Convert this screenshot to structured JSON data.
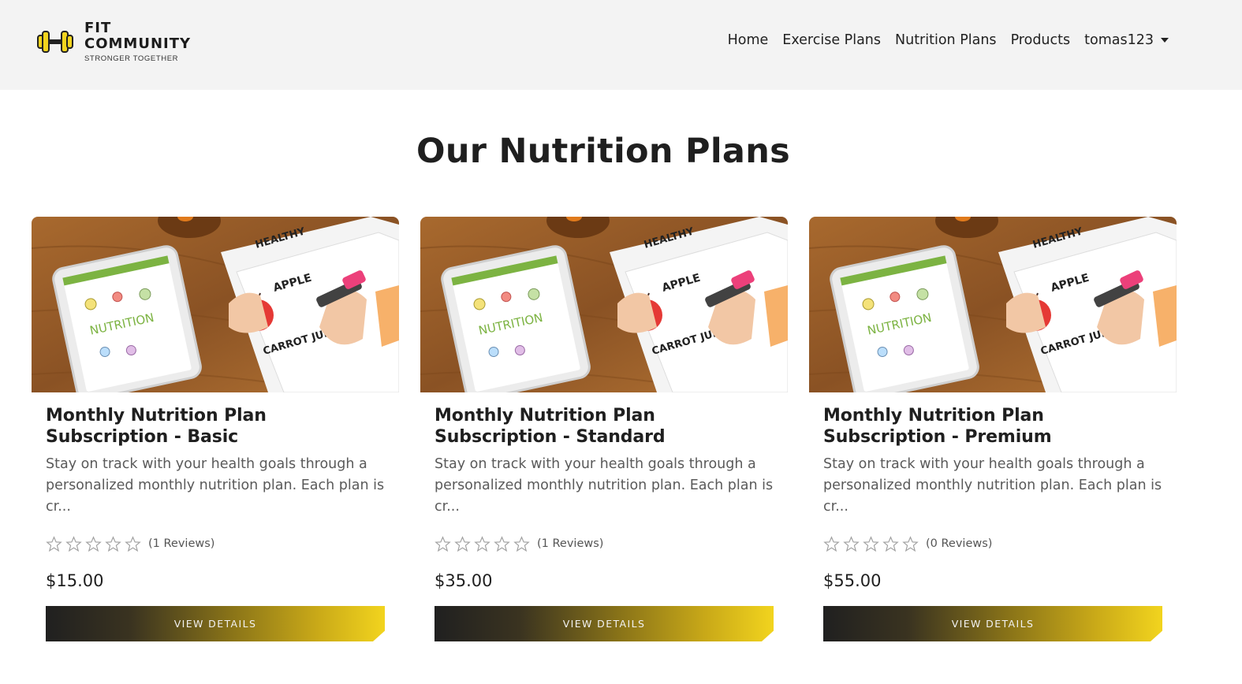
{
  "brand": {
    "line1": "FIT",
    "line2": "COMMUNITY",
    "tagline": "STRONGER TOGETHER",
    "icon": "dumbbell-icon",
    "accent_color": "#f2d41e"
  },
  "nav": {
    "items": [
      {
        "label": "Home"
      },
      {
        "label": "Exercise Plans"
      },
      {
        "label": "Nutrition Plans"
      },
      {
        "label": "Products"
      }
    ],
    "user": "tomas123"
  },
  "page": {
    "title": "Our Nutrition Plans"
  },
  "plans": [
    {
      "title": "Monthly Nutrition Plan Subscription - Basic",
      "description": "Stay on track with your health goals through a personalized monthly nutrition plan. Each plan is cr...",
      "rating": 0,
      "reviews": "(1 Reviews)",
      "price": "$15.00",
      "button": "VIEW DETAILS"
    },
    {
      "title": "Monthly Nutrition Plan Subscription - Standard",
      "description": "Stay on track with your health goals through a personalized monthly nutrition plan. Each plan is cr...",
      "rating": 0,
      "reviews": "(1 Reviews)",
      "price": "$35.00",
      "button": "VIEW DETAILS"
    },
    {
      "title": "Monthly Nutrition Plan Subscription - Premium",
      "description": "Stay on track with your health goals through a personalized monthly nutrition plan. Each plan is cr...",
      "rating": 0,
      "reviews": "(0 Reviews)",
      "price": "$55.00",
      "button": "VIEW DETAILS"
    }
  ],
  "image_labels": {
    "tablet": "NUTRITION",
    "sheet_top": "HEALTHY",
    "sheet_apple": "APPLE",
    "sheet_carrot": "CARROT JUICE"
  }
}
